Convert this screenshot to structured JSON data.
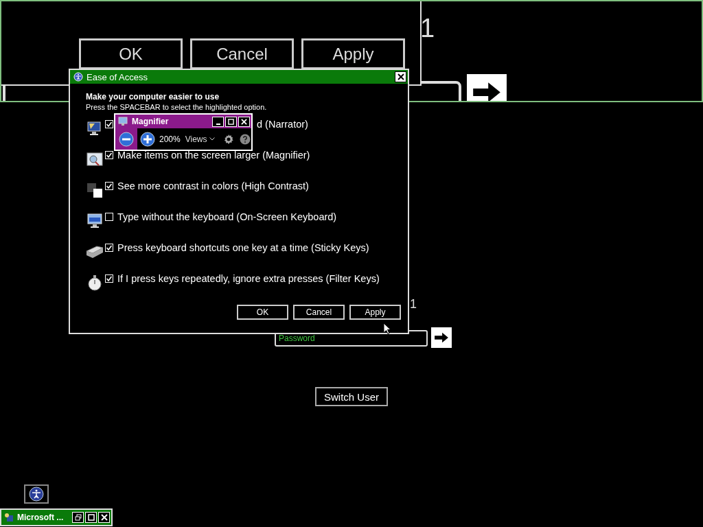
{
  "magnified_view": {
    "buttons": [
      {
        "label": "OK"
      },
      {
        "label": "Cancel"
      },
      {
        "label": "Apply"
      }
    ],
    "user_name_fragment": "1"
  },
  "dialog": {
    "title": "Ease of Access",
    "heading": "Make your computer easier to use",
    "hint": "Press the SPACEBAR to select the highlighted option.",
    "options": [
      {
        "kind": "covered",
        "label": "d (Narrator)",
        "checked": true
      },
      {
        "kind": "plain",
        "label": "Make items on the screen larger (Magnifier)",
        "checked": true
      },
      {
        "kind": "plain",
        "label": "See more contrast in colors (High Contrast)",
        "checked": true
      },
      {
        "kind": "plain",
        "label": "Type without the keyboard (On-Screen Keyboard)",
        "checked": false
      },
      {
        "kind": "plain",
        "label": "Press keyboard shortcuts one key at a time (Sticky Keys)",
        "checked": true
      },
      {
        "kind": "plain",
        "label": "If I press keys repeatedly, ignore extra presses (Filter Keys)",
        "checked": true
      }
    ],
    "buttons": [
      {
        "label": "OK"
      },
      {
        "label": "Cancel"
      },
      {
        "label": "Apply"
      }
    ]
  },
  "magnifier": {
    "title": "Magnifier",
    "zoom": "200%",
    "views": "Views"
  },
  "login": {
    "user_name_fragment": "1",
    "password": {
      "placeholder": "Password"
    },
    "switch_user": "Switch User"
  },
  "minimized_window": {
    "title": "Microsoft ..."
  }
}
